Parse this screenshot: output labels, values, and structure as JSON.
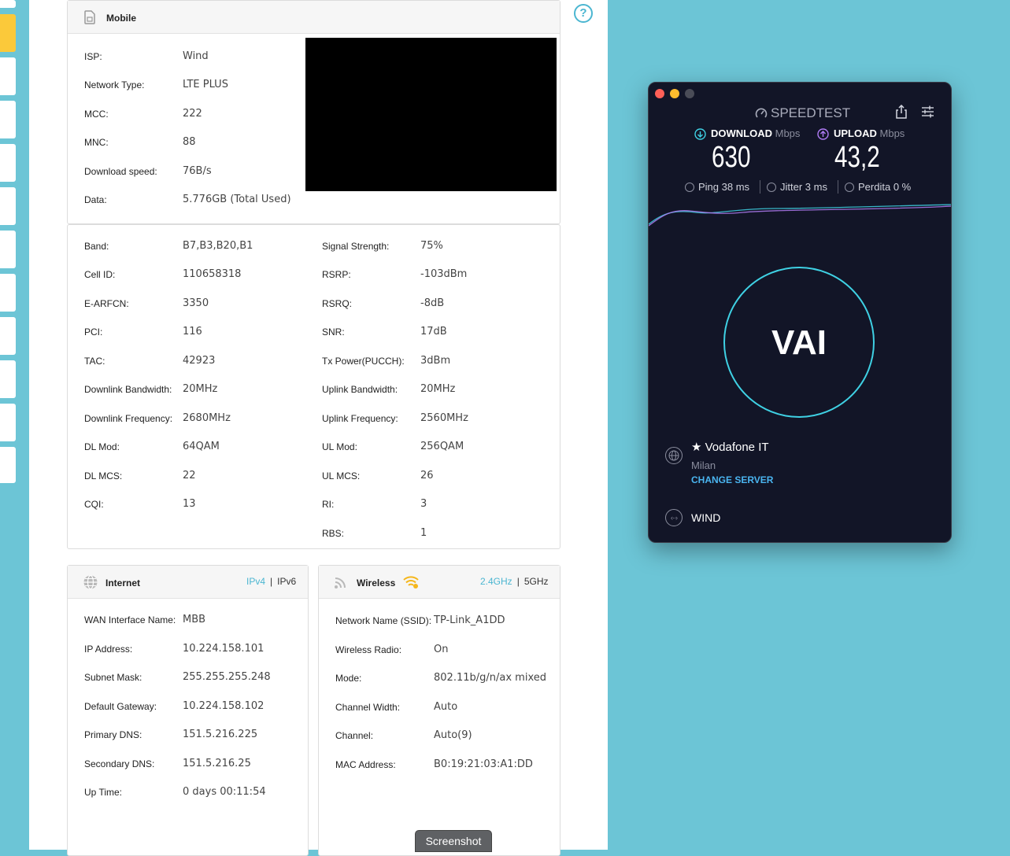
{
  "mobile": {
    "title": "Mobile",
    "rows": [
      {
        "label": "ISP:",
        "value": "Wind"
      },
      {
        "label": "Network Type:",
        "value": "LTE PLUS"
      },
      {
        "label": "MCC:",
        "value": "222"
      },
      {
        "label": "MNC:",
        "value": "88"
      },
      {
        "label": "Download speed:",
        "value": "76B/s"
      },
      {
        "label": "Data:",
        "value": "5.776GB (Total Used)"
      }
    ]
  },
  "cell": {
    "left": [
      {
        "label": "Band:",
        "value": "B7,B3,B20,B1"
      },
      {
        "label": "Cell ID:",
        "value": "110658318"
      },
      {
        "label": "E-ARFCN:",
        "value": "3350"
      },
      {
        "label": "PCI:",
        "value": "116"
      },
      {
        "label": "TAC:",
        "value": "42923"
      },
      {
        "label": "Downlink Bandwidth:",
        "value": "20MHz"
      },
      {
        "label": "Downlink Frequency:",
        "value": "2680MHz"
      },
      {
        "label": "DL Mod:",
        "value": "64QAM"
      },
      {
        "label": "DL MCS:",
        "value": "22"
      },
      {
        "label": "CQI:",
        "value": "13"
      }
    ],
    "right": [
      {
        "label": "Signal Strength:",
        "value": "75%"
      },
      {
        "label": "RSRP:",
        "value": "-103dBm"
      },
      {
        "label": "RSRQ:",
        "value": "-8dB"
      },
      {
        "label": "SNR:",
        "value": "17dB"
      },
      {
        "label": "Tx Power(PUCCH):",
        "value": "3dBm"
      },
      {
        "label": "Uplink Bandwidth:",
        "value": "20MHz"
      },
      {
        "label": "Uplink Frequency:",
        "value": "2560MHz"
      },
      {
        "label": "UL Mod:",
        "value": "256QAM"
      },
      {
        "label": "UL MCS:",
        "value": "26"
      },
      {
        "label": "RI:",
        "value": "3"
      },
      {
        "label": "RBS:",
        "value": "1"
      }
    ]
  },
  "internet": {
    "title": "Internet",
    "ipv4": "IPv4",
    "ipv6": "IPv6",
    "separator": "|",
    "rows": [
      {
        "label": "WAN Interface Name:",
        "value": "MBB"
      },
      {
        "label": "IP Address:",
        "value": "10.224.158.101"
      },
      {
        "label": "Subnet Mask:",
        "value": "255.255.255.248"
      },
      {
        "label": "Default Gateway:",
        "value": "10.224.158.102"
      },
      {
        "label": "Primary DNS:",
        "value": "151.5.216.225"
      },
      {
        "label": "Secondary DNS:",
        "value": "151.5.216.25"
      },
      {
        "label": "Up Time:",
        "value": "0 days 00:11:54"
      }
    ]
  },
  "wireless": {
    "title": "Wireless",
    "band_24": "2.4GHz",
    "band_5": "5GHz",
    "separator": "|",
    "rows": [
      {
        "label": "Network Name (SSID):",
        "value": "TP-Link_A1DD"
      },
      {
        "label": "Wireless Radio:",
        "value": "On"
      },
      {
        "label": "Mode:",
        "value": "802.11b/g/n/ax mixed"
      },
      {
        "label": "Channel Width:",
        "value": "Auto"
      },
      {
        "label": "Channel:",
        "value": "Auto(9)"
      },
      {
        "label": "MAC Address:",
        "value": "B0:19:21:03:A1:DD"
      }
    ]
  },
  "help_icon_glyph": "?",
  "screenshot_button": "Screenshot",
  "speedtest": {
    "title": "SPEEDTEST",
    "download_label": "DOWNLOAD",
    "upload_label": "UPLOAD",
    "unit": "Mbps",
    "download_value": "630",
    "upload_value": "43,2",
    "ping_label": "Ping",
    "ping_value": "38 ms",
    "jitter_label": "Jitter",
    "jitter_value": "3 ms",
    "loss_label": "Perdita",
    "loss_value": "0 %",
    "go_label": "VAI",
    "server_name": "Vodafone IT",
    "server_city": "Milan",
    "change_server": "CHANGE SERVER",
    "provider": "WIND",
    "colors": {
      "accent": "#3fd1e4",
      "upload": "#b07cf5",
      "link": "#4ab5f0"
    }
  }
}
